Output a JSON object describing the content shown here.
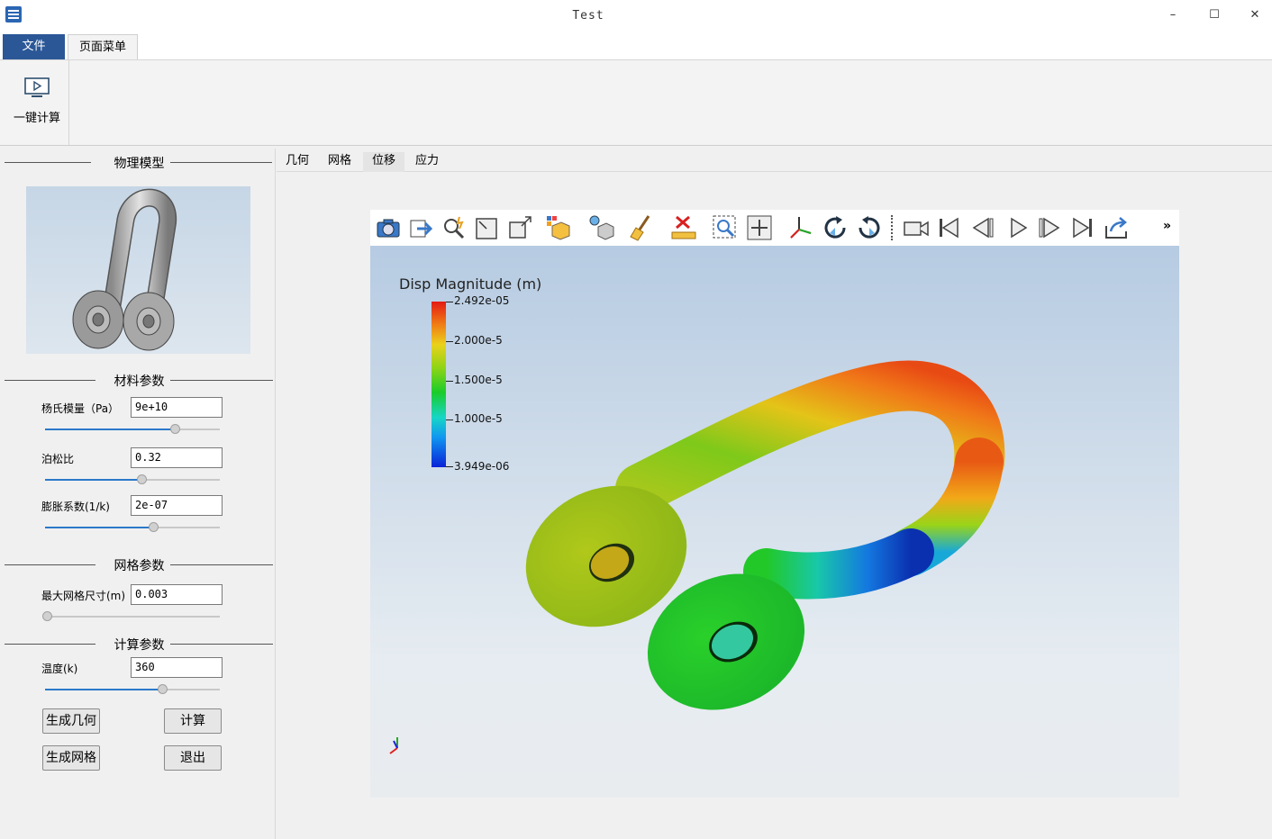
{
  "window": {
    "title": "Test",
    "minimize": "–",
    "maximize": "☐",
    "close": "✕"
  },
  "ribbon": {
    "tabs": [
      "文件",
      "页面菜单"
    ],
    "calc_button": "一键计算"
  },
  "left_panel": {
    "model_group": "物理模型",
    "material_group": "材料参数",
    "mesh_group": "网格参数",
    "calc_group": "计算参数",
    "youngs_label": "杨氏模量（Pa）",
    "youngs_value": "9e+10",
    "youngs_level": 0.74,
    "poisson_label": "泊松比",
    "poisson_value": "0.32",
    "poisson_level": 0.55,
    "expansion_label": "膨胀系数(1/k)",
    "expansion_value": "2e-07",
    "expansion_level": 0.62,
    "mesh_label": "最大网格尺寸(m)",
    "mesh_value": "0.003",
    "mesh_level": 0.01,
    "temp_label": "温度(k)",
    "temp_value": "360",
    "temp_level": 0.67,
    "btn_geometry": "生成几何",
    "btn_compute": "计算",
    "btn_mesh": "生成网格",
    "btn_exit": "退出"
  },
  "view_tabs": [
    "几何",
    "网格",
    "位移",
    "应力"
  ],
  "active_view_tab": "位移",
  "toolbar_icons": [
    "camera-icon",
    "export-icon",
    "pick-icon",
    "select-region-icon",
    "reset-camera-icon",
    "cube-view-icon",
    "lighting-icon",
    "clear-icon",
    "ruler-icon",
    "zoom-box-icon",
    "zoom-fit-icon",
    "axes-icon",
    "rotate-cw-icon",
    "rotate-ccw-icon",
    "record-icon",
    "first-frame-icon",
    "prev-frame-icon",
    "play-icon",
    "next-frame-icon",
    "last-frame-icon",
    "share-icon"
  ],
  "toolbar_more": "»",
  "legend": {
    "title": "Disp Magnitude (m)",
    "labels": [
      "2.492e-05",
      "2.000e-5",
      "1.500e-5",
      "1.000e-5",
      "3.949e-06"
    ]
  }
}
